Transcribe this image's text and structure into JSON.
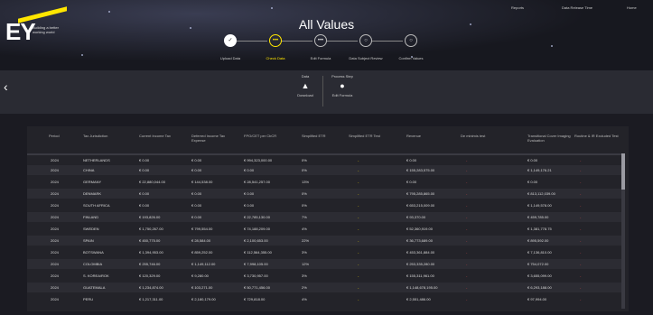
{
  "header": {
    "title": "All Values",
    "logo_text": "EY",
    "logo_tagline": "Building a better working world",
    "topnav": [
      "Reports",
      "Data Release Time",
      "Home"
    ]
  },
  "stepper": {
    "steps": [
      {
        "label": "Upload Data",
        "state": "done",
        "glyph": "✓"
      },
      {
        "label": "Check Data",
        "state": "current",
        "glyph": "•••"
      },
      {
        "label": "Edit Formula",
        "state": "todo",
        "glyph": "•••"
      },
      {
        "label": "Data Subject Review",
        "state": "todo",
        "glyph": "○"
      },
      {
        "label": "Confirm Values",
        "state": "todo",
        "glyph": "○"
      }
    ]
  },
  "toolbar": {
    "back_glyph": "‹",
    "items": [
      {
        "group": "Data",
        "label": "Download",
        "glyph": "▲"
      },
      {
        "group": "Process Step",
        "label": "Edit Formula",
        "glyph": "●"
      }
    ]
  },
  "table": {
    "columns": [
      "Period",
      "Tax Jurisdiction",
      "Current Income Tax",
      "Deferred Income Tax Expense",
      "FPO/CET per CbCR",
      "Simplified ETR",
      "Simplified ETR Test",
      "Revenue",
      "De minimis test",
      "Transitional Cover Imaging Evaluation",
      "Routine & IR Excluded Test"
    ],
    "rows": [
      [
        "2024",
        "NETHERLANDS",
        "€ 0.00",
        "€ 0.00",
        "€ 994,323,000.00",
        "0%",
        "-",
        "€ 0.00",
        "-",
        "€ 0.00",
        "-"
      ],
      [
        "2024",
        "CHINA",
        "€ 0.00",
        "€ 0.00",
        "€ 0.00",
        "0%",
        "-",
        "€ 155,283,575.00",
        "-",
        "€ 1,149,176.21",
        "-"
      ],
      [
        "2024",
        "GERMANY",
        "€ 22,880,044.00",
        "€ 144,538.00",
        "€ 28,541,257.00",
        "13%",
        "-",
        "€ 0.00",
        "-",
        "€ 0.00",
        "-"
      ],
      [
        "2024",
        "DENMARK",
        "€ 0.00",
        "€ 0.00",
        "€ 0.00",
        "0%",
        "-",
        "€ 795,285,865.00",
        "-",
        "€ 813,112,039.00",
        "-"
      ],
      [
        "2024",
        "SOUTH AFRICA",
        "€ 0.00",
        "€ 0.00",
        "€ 0.00",
        "0%",
        "-",
        "€ 653,215,009.00",
        "-",
        "€ 1,149,578.00",
        "-"
      ],
      [
        "2024",
        "FINLAND",
        "€ 193,826.00",
        "€ 0.00",
        "€ 22,785,130.00",
        "7%",
        "-",
        "€ 93,370.00",
        "-",
        "€ 459,785.00",
        "-"
      ],
      [
        "2024",
        "SWEDEN",
        "€ 1,750,267.00",
        "€ 799,554.00",
        "€ 74,188,209.00",
        "4%",
        "-",
        "€ 52,360,919.00",
        "-",
        "€ 1,381,778.75",
        "-"
      ],
      [
        "2024",
        "SPAIN",
        "€ 450,775.00",
        "€ 28,584.00",
        "€ 2,100,653.00",
        "22%",
        "-",
        "€ 36,773,689.00",
        "-",
        "€ 895,592.00",
        "-"
      ],
      [
        "2024",
        "BOTSWANA",
        "€ 1,394,953.00",
        "€ 859,252.00",
        "€ 112,564,355.00",
        "3%",
        "-",
        "€ 453,361,884.00",
        "-",
        "€ 7,136,810.00",
        "-"
      ],
      [
        "2024",
        "COLOMBIA",
        "€ 255,746.00",
        "€ 1,149,112.00",
        "€ 7,998,105.00",
        "12%",
        "-",
        "€ 253,335,280.00",
        "-",
        "€ 754,072.00",
        "-"
      ],
      [
        "2024",
        "S. KOREA/ROK",
        "€ 120,329.00",
        "€ 9,280.00",
        "€ 3,730,957.00",
        "3%",
        "-",
        "€ 155,311,961.00",
        "-",
        "€ 3,655,099.00",
        "-"
      ],
      [
        "2024",
        "GUATEMALA",
        "€ 1,234,874.00",
        "€ 103,271.00",
        "€ 50,771,456.00",
        "2%",
        "-",
        "€ 1,148,678,195.00",
        "-",
        "€ 6,293,188.00",
        "-"
      ],
      [
        "2024",
        "PERU",
        "€ 1,217,311.00",
        "€ 2,180,179.00",
        "€ 729,818.00",
        "4%",
        "-",
        "€ 2,551,486.00",
        "-",
        "€ 97,994.00",
        "-"
      ]
    ]
  }
}
